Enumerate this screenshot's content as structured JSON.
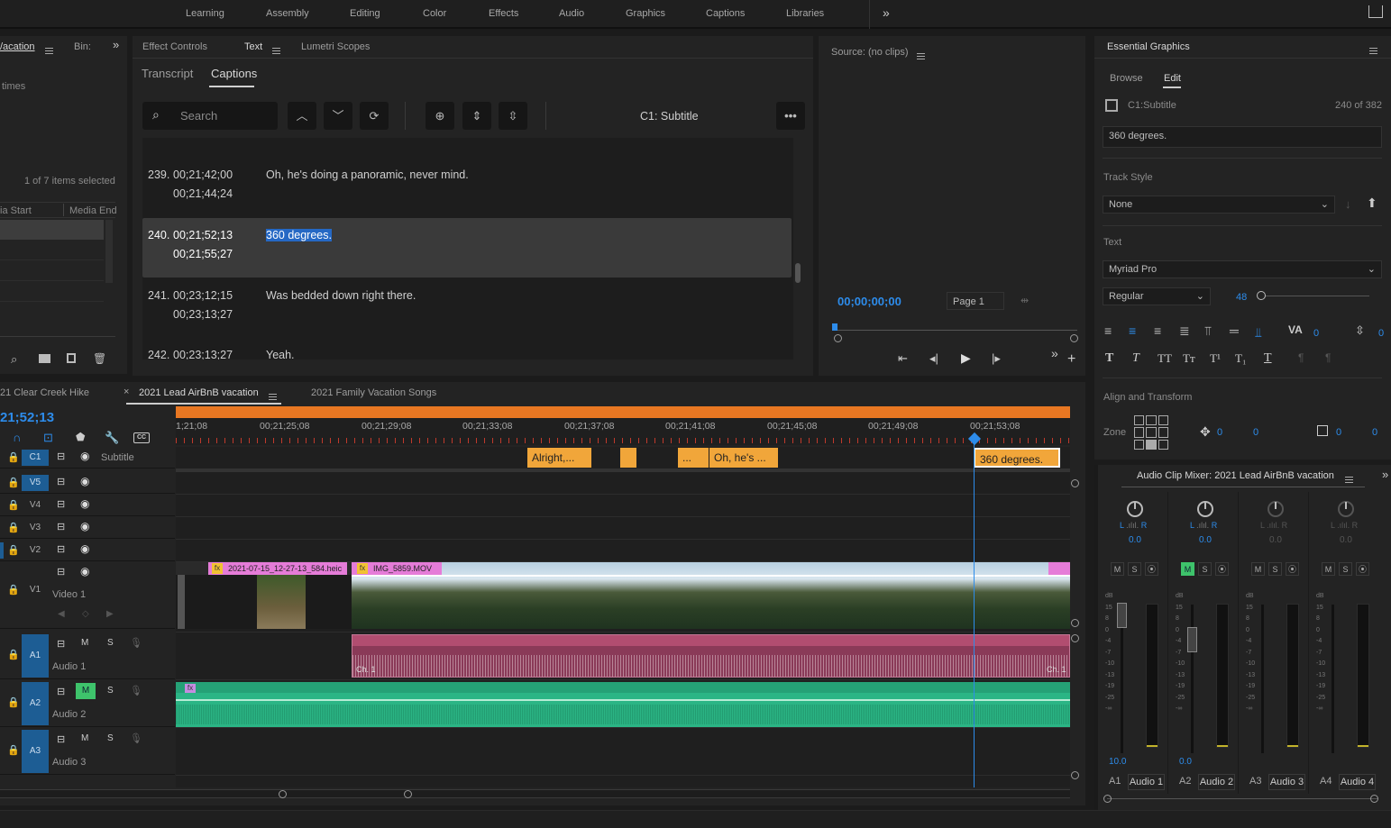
{
  "workspaces": [
    "Learning",
    "Assembly",
    "Editing",
    "Color",
    "Effects",
    "Audio",
    "Graphics",
    "Captions",
    "Libraries"
  ],
  "project_panel": {
    "tab1": "/acation",
    "tab2": "Bin:",
    "search_text": "times",
    "selection_status": "1 of 7 items selected",
    "col1": "ia Start",
    "col2": "Media End"
  },
  "text_panel": {
    "tabs": [
      "Effect Controls",
      "Text",
      "Lumetri Scopes"
    ],
    "subtabs": [
      "Transcript",
      "Captions"
    ],
    "search_placeholder": "Search",
    "track_label": "C1: Subtitle",
    "captions": [
      {
        "num": "239.",
        "in": "00;21;42;00",
        "out": "00;21;44;24",
        "text": "Oh, he's doing a panoramic, never mind."
      },
      {
        "num": "240.",
        "in": "00;21;52;13",
        "out": "00;21;55;27",
        "text": "360 degrees."
      },
      {
        "num": "241.",
        "in": "00;23;12;15",
        "out": "00;23;13;27",
        "text": "Was bedded down right there."
      },
      {
        "num": "242.",
        "in": "00;23;13;27",
        "out": "",
        "text": "Yeah."
      }
    ]
  },
  "source_monitor": {
    "title": "Source: (no clips)",
    "timecode": "00;00;00;00",
    "page": "Page 1"
  },
  "essential_graphics": {
    "title": "Essential Graphics",
    "tabs": [
      "Browse",
      "Edit"
    ],
    "layer_label": "C1:Subtitle",
    "layer_count": "240 of 382",
    "caption_text": "360 degrees.",
    "track_style_label": "Track Style",
    "track_style_value": "None",
    "text_label": "Text",
    "font": "Myriad Pro",
    "font_style": "Regular",
    "font_size": "48",
    "tracking": "0",
    "leading": "0",
    "align_label": "Align and Transform",
    "zone_label": "Zone",
    "pos_x": "0",
    "pos_y": "0",
    "scale_x": "0",
    "scale_y": "0"
  },
  "timeline": {
    "tabs": [
      "21 Clear Creek Hike",
      "2021 Lead AirBnB vacation",
      "2021 Family Vacation Songs"
    ],
    "timecode": "21;52;13",
    "ruler": [
      "1;21;08",
      "00;21;25;08",
      "00;21;29;08",
      "00;21;33;08",
      "00;21;37;08",
      "00;21;41;08",
      "00;21;45;08",
      "00;21;49;08",
      "00;21;53;08"
    ],
    "tracks": {
      "c1": {
        "label": "C1",
        "name": "Subtitle"
      },
      "v5": "V5",
      "v4": "V4",
      "v3": "V3",
      "v2": "V2",
      "v1": {
        "label": "V1",
        "name": "Video 1"
      },
      "a1": {
        "label": "A1",
        "name": "Audio 1"
      },
      "a2": {
        "label": "A2",
        "name": "Audio 2"
      },
      "a3": {
        "label": "A3",
        "name": "Audio 3"
      }
    },
    "caption_clips": [
      "Alright,...",
      "...",
      "Oh, he's ...",
      "360 degrees."
    ],
    "video_clips": [
      "2021-07-15_12-27-13_584.heic",
      "IMG_5859.MOV"
    ],
    "audio_clip_labels": [
      "Ch. 1",
      "Ch. 1"
    ]
  },
  "audio_mixer": {
    "title": "Audio Clip Mixer: 2021 Lead AirBnB vacation",
    "channels": [
      {
        "id": "A1",
        "name": "Audio 1",
        "pan": "0.0",
        "level": "10.0"
      },
      {
        "id": "A2",
        "name": "Audio 2",
        "pan": "0.0",
        "level": "0.0"
      },
      {
        "id": "A3",
        "name": "Audio 3",
        "pan": "0.0",
        "level": ""
      },
      {
        "id": "A4",
        "name": "Audio 4",
        "pan": "0.0",
        "level": ""
      }
    ],
    "db_scale": [
      "dB",
      "15",
      "8",
      "0",
      "-4",
      "-7",
      "-10",
      "-13",
      "-19",
      "-25",
      "-∞"
    ]
  },
  "colors": {
    "accent": "#2d8ceb",
    "caption_clip": "#f1a63a",
    "audio1": "#8a3a58",
    "audio2": "#2bb585",
    "work_area": "#e87722"
  }
}
